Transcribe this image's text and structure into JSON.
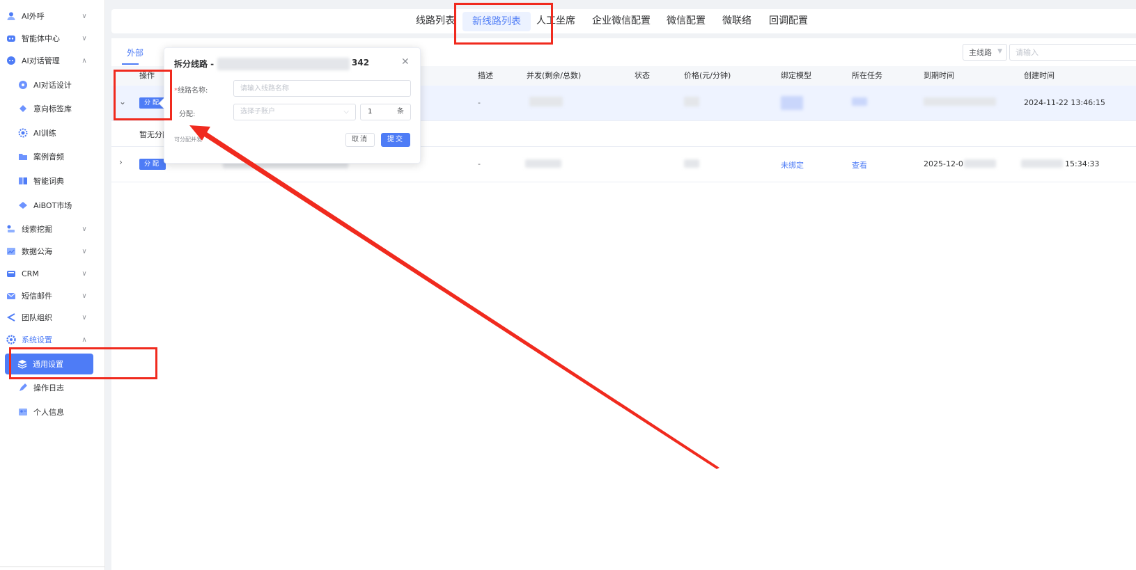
{
  "sidebar": {
    "items": [
      {
        "label": "AI外呼",
        "icon": "user-icon",
        "chevron": "∨"
      },
      {
        "label": "智能体中心",
        "icon": "robot-icon",
        "chevron": "∨"
      },
      {
        "label": "AI对话管理",
        "icon": "chat-icon",
        "chevron": "∧"
      },
      {
        "label": "AI对话设计",
        "icon": "chat-design-icon"
      },
      {
        "label": "意向标签库",
        "icon": "tag-icon"
      },
      {
        "label": "AI训练",
        "icon": "gear-chip-icon"
      },
      {
        "label": "案例音频",
        "icon": "folder-icon"
      },
      {
        "label": "智能词典",
        "icon": "book-icon"
      },
      {
        "label": "AiBOT市场",
        "icon": "diamond-icon"
      },
      {
        "label": "线索挖掘",
        "icon": "clue-icon",
        "chevron": "∨"
      },
      {
        "label": "数据公海",
        "icon": "chart-icon",
        "chevron": "∨"
      },
      {
        "label": "CRM",
        "icon": "crm-icon",
        "chevron": "∨"
      },
      {
        "label": "短信邮件",
        "icon": "mail-icon",
        "chevron": "∨"
      },
      {
        "label": "团队组织",
        "icon": "share-icon",
        "chevron": "∨"
      },
      {
        "label": "系统设置",
        "icon": "settings-icon",
        "chevron": "∧"
      },
      {
        "label": "通用设置",
        "icon": "layers-icon"
      },
      {
        "label": "操作日志",
        "icon": "pen-icon"
      },
      {
        "label": "个人信息",
        "icon": "profile-icon"
      }
    ]
  },
  "top_tabs": [
    {
      "label": "线路列表"
    },
    {
      "label": "新线路列表"
    },
    {
      "label": "人工坐席"
    },
    {
      "label": "企业微信配置"
    },
    {
      "label": "微信配置"
    },
    {
      "label": "微联络"
    },
    {
      "label": "回调配置"
    }
  ],
  "sub_tab": {
    "label": "外部"
  },
  "filter": {
    "select_value": "主线路",
    "input_placeholder": "请输入"
  },
  "table": {
    "headers": [
      "操作",
      "描述",
      "并发(剩余/总数)",
      "状态",
      "价格(元/分钟)",
      "绑定模型",
      "所在任务",
      "到期时间",
      "创建时间"
    ],
    "assign_label": "分配",
    "rows": [
      {
        "description": "-",
        "created": "2024-11-22 13:46:15"
      },
      {
        "description": "-",
        "bind_model": "未绑定",
        "task": "查看",
        "expire_prefix": "2025-12-0",
        "created_suffix": "15:34:33"
      }
    ],
    "empty_text": "暂无分配"
  },
  "popover": {
    "title": "拆分线路 -",
    "title_suffix": "342",
    "name_label": "线路名称:",
    "name_placeholder": "请输入线路名称",
    "assign_label": "分配:",
    "account_placeholder": "选择子账户",
    "count_value": "1",
    "count_unit": "条",
    "hint": "可分配并发",
    "cancel_label": "取消",
    "submit_label": "提交"
  },
  "colors": {
    "accent": "#4e7cf6",
    "annotation": "#f02a1e"
  }
}
